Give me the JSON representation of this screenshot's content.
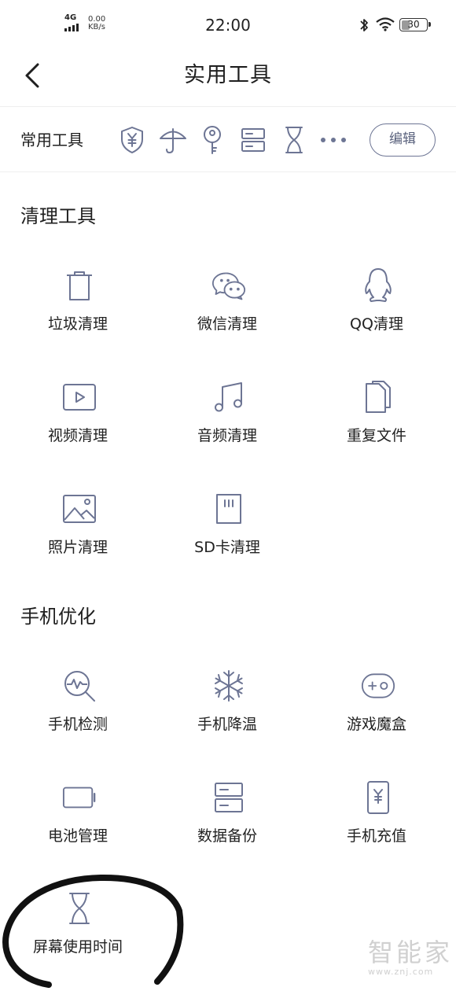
{
  "status_bar": {
    "network": "4G",
    "speed_value": "0.00",
    "speed_unit": "KB/s",
    "time": "22:00",
    "battery": "30"
  },
  "header": {
    "title": "实用工具"
  },
  "common_tools": {
    "label": "常用工具",
    "icons": [
      "shield-yuan-icon",
      "umbrella-icon",
      "key-icon",
      "storage-icon",
      "hourglass-icon",
      "more-dots-icon"
    ],
    "edit_label": "编辑"
  },
  "sections": {
    "cleanup": {
      "title": "清理工具",
      "items": [
        {
          "label": "垃圾清理",
          "icon": "trash-icon"
        },
        {
          "label": "微信清理",
          "icon": "wechat-icon"
        },
        {
          "label": "QQ清理",
          "icon": "qq-penguin-icon"
        },
        {
          "label": "视频清理",
          "icon": "video-icon"
        },
        {
          "label": "音频清理",
          "icon": "music-note-icon"
        },
        {
          "label": "重复文件",
          "icon": "duplicate-files-icon"
        },
        {
          "label": "照片清理",
          "icon": "photo-icon"
        },
        {
          "label": "SD卡清理",
          "icon": "sd-card-icon"
        }
      ]
    },
    "optimize": {
      "title": "手机优化",
      "items": [
        {
          "label": "手机检测",
          "icon": "phone-check-icon"
        },
        {
          "label": "手机降温",
          "icon": "snowflake-icon"
        },
        {
          "label": "游戏魔盒",
          "icon": "gamepad-icon"
        },
        {
          "label": "电池管理",
          "icon": "battery-icon"
        },
        {
          "label": "数据备份",
          "icon": "data-backup-icon"
        },
        {
          "label": "手机充值",
          "icon": "phone-recharge-icon"
        },
        {
          "label": "屏幕使用时间",
          "icon": "hourglass-icon"
        }
      ]
    }
  },
  "watermark": {
    "brand": "智能家",
    "url": "www.znj.com"
  },
  "colors": {
    "icon_stroke": "#6d7594",
    "text": "#1f1f1f",
    "divider": "#efefef"
  }
}
